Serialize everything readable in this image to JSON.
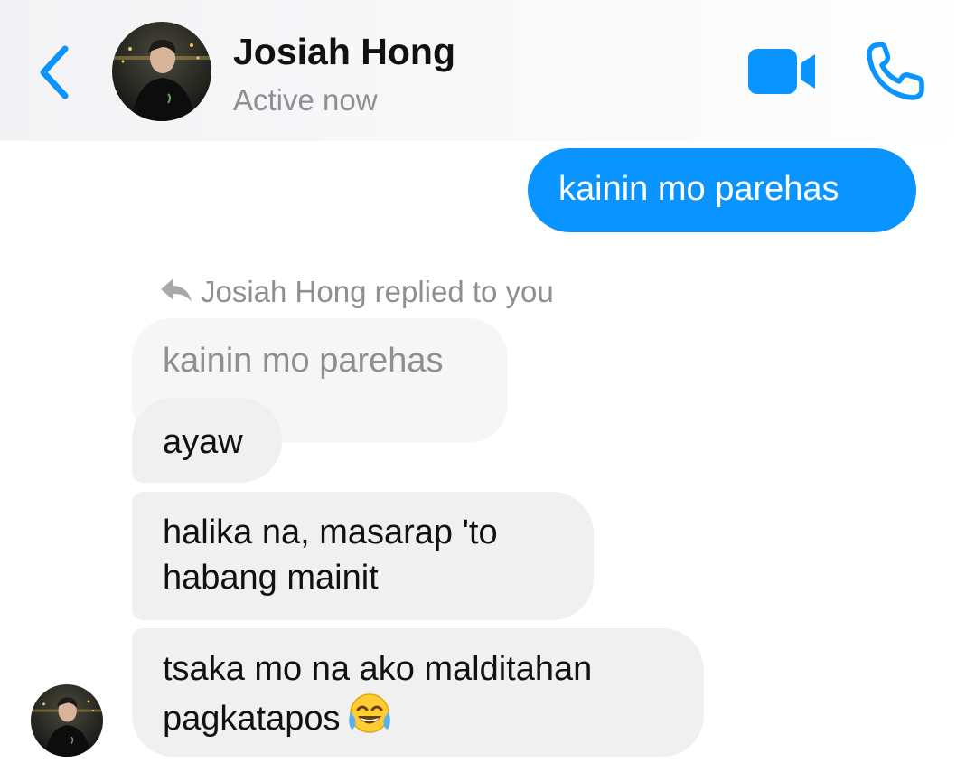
{
  "header": {
    "back_icon": "chevron-left-icon",
    "contact_name": "Josiah Hong",
    "status": "Active now",
    "video_icon": "video-camera-icon",
    "phone_icon": "phone-icon",
    "accent_color": "#0a94ff"
  },
  "messages": {
    "sent": {
      "text": "kainin mo parehas",
      "color": "#0a94ff"
    },
    "reply_label": "Josiah Hong replied to you",
    "reply_icon": "reply-arrow-icon",
    "quoted_text": "kainin mo parehas",
    "received": [
      {
        "lines": [
          "ayaw"
        ]
      },
      {
        "lines": [
          "halika na, masarap 'to",
          "habang mainit"
        ]
      },
      {
        "lines": [
          "tsaka mo na ako malditahan",
          "pagkatapos"
        ],
        "emoji": "tears-of-joy-emoji"
      }
    ]
  }
}
